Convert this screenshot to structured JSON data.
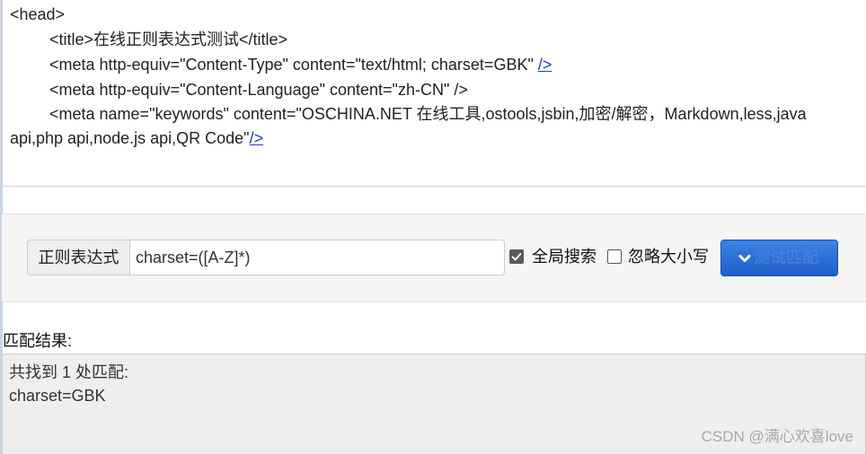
{
  "source_code": {
    "line_head": "<head>",
    "line_title": "<title>在线正则表达式测试</title>",
    "line_meta1_text": "<meta http-equiv=\"Content-Type\" content=\"text/html; charset=GBK\" ",
    "line_meta1_link": "/>",
    "line_meta2": "<meta http-equiv=\"Content-Language\" content=\"zh-CN\" />",
    "line_meta3": "<meta name=\"keywords\" content=\"OSCHINA.NET 在线工具,ostools,jsbin,加密/解密，Markdown,less,java",
    "line_meta3b_text": "api,php api,node.js api,QR Code\"",
    "line_meta3b_link": "/>"
  },
  "regex_form": {
    "addon_label": "正则表达式",
    "regex_value": "charset=([A-Z]*)",
    "global_search_label": "全局搜索",
    "global_search_checked": true,
    "ignore_case_label": "忽略大小写",
    "ignore_case_checked": false,
    "test_button_label": "测试匹配",
    "test_button_icon": "chevron-down-icon"
  },
  "result": {
    "label": "匹配结果:",
    "summary": "共找到 1 处匹配:",
    "match": "charset=GBK"
  },
  "watermark": "CSDN @满心欢喜love",
  "colors": {
    "button_blue": "#2a6fd6",
    "link_blue": "#1a3fc9"
  }
}
